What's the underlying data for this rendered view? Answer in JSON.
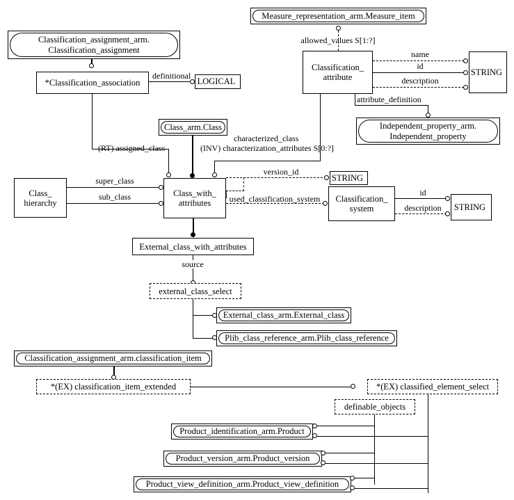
{
  "diagram": {
    "type": "EXPRESS-G entity-level diagram",
    "entities": {
      "classification_assignment_ref": "Classification_assignment_arm.\nClassification_assignment",
      "classification_assignment_ref_l1": "Classification_assignment_arm.",
      "classification_assignment_ref_l2": "Classification_assignment",
      "classification_association": "*Classification_association",
      "logical": "LOGICAL",
      "measure_item_ref": "Measure_representation_arm.Measure_item",
      "classification_attribute_l1": "Classification_",
      "classification_attribute_l2": "attribute",
      "string_1": "STRING",
      "independent_property_ref_l1": "Independent_property_arm.",
      "independent_property_ref_l2": "Independent_property",
      "class_arm_class_ref": "Class_arm.Class",
      "class_hierarchy_l1": "Class_",
      "class_hierarchy_l2": "hierarchy",
      "class_with_attributes_l1": "Class_with_",
      "class_with_attributes_l2": "attributes",
      "string_2": "STRING",
      "classification_system_l1": "Classification_",
      "classification_system_l2": "system",
      "string_3": "STRING",
      "external_class_with_attributes": "External_class_with_attributes",
      "external_class_select": "external_class_select",
      "external_class_ref": "External_class_arm.External_class",
      "plib_class_reference_ref": "Plib_class_reference_arm.Plib_class_reference",
      "classification_item_ref": "Classification_assignment_arm.classification_item",
      "classification_item_extended": "*(EX) classification_item_extended",
      "classified_element_select": "*(EX) classified_element_select",
      "definable_objects": "definable_objects",
      "product_ref": "Product_identification_arm.Product",
      "product_version_ref": "Product_version_arm.Product_version",
      "product_view_definition_ref": "Product_view_definition_arm.Product_view_definition"
    },
    "attribute_labels": {
      "definitional": "definitional",
      "allowed_values": "allowed_values S[1:?]",
      "name": "name",
      "id_attr": "id",
      "description": "description",
      "attribute_definition": "attribute_definition",
      "assigned_class": "(RT) assigned_class",
      "characterized_class": "characterized_class",
      "characterization_attributes": "(INV) characterization_attributes S[0:?]",
      "super_class": "super_class",
      "sub_class": "sub_class",
      "version_id": "version_id",
      "used_classification_system": "used_classification_system",
      "system_id": "id",
      "system_description": "description",
      "source": "source"
    },
    "colors": {
      "line": "#000000",
      "text": "#000000",
      "background": "#ffffff"
    }
  }
}
